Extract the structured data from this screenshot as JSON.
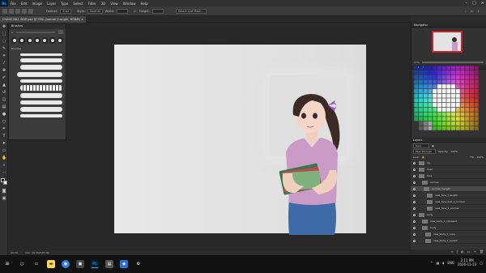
{
  "app": {
    "logo": "Ps"
  },
  "menu": [
    "File",
    "Edit",
    "Image",
    "Layer",
    "Type",
    "Select",
    "Filter",
    "3D",
    "View",
    "Window",
    "Help"
  ],
  "options_bar": {
    "feather_label": "Feather:",
    "feather_value": "0 px",
    "style_label": "Style:",
    "style_value": "Normal",
    "width_label": "Width:",
    "height_label": "Height:",
    "select_mask": "Select and Mask..."
  },
  "document_tab": "CHASE MILL SIDE.psd @ 33% (normal / Length, RGB/8)",
  "brushes_panel": {
    "title": "Brushes",
    "size_value": "4",
    "group_label": "Brushes"
  },
  "navigator": {
    "title": "Navigator",
    "zoom": "33%"
  },
  "swatches": {
    "title": "Swatches"
  },
  "layers_panel": {
    "tab": "Layers",
    "kind_placeholder": "Kind",
    "blend_mode": "Pass Through",
    "opacity_label": "Opacity:",
    "opacity_value": "100%",
    "lock_label": "Lock:",
    "fill_label": "Fill:",
    "fill_value": "100%",
    "items": [
      "bg",
      "lines",
      "face",
      "normal",
      "normal / length",
      "new_face_f_length",
      "new_face_bob_2_normal",
      "new_face_2_normal",
      "body",
      "new_body_1_released",
      "body",
      "new_body_1_copy",
      "new_body_1_ended"
    ]
  },
  "status_bar": {
    "zoom": "33.3%",
    "doc_size": "Doc: 24.3M/395.6M"
  },
  "taskbar": {
    "time": "2:11 PM",
    "date": "2020-11-13",
    "lang": "ENG"
  },
  "colors": {
    "selection": "#c8232d",
    "ps_blue": "#31a8ff"
  }
}
